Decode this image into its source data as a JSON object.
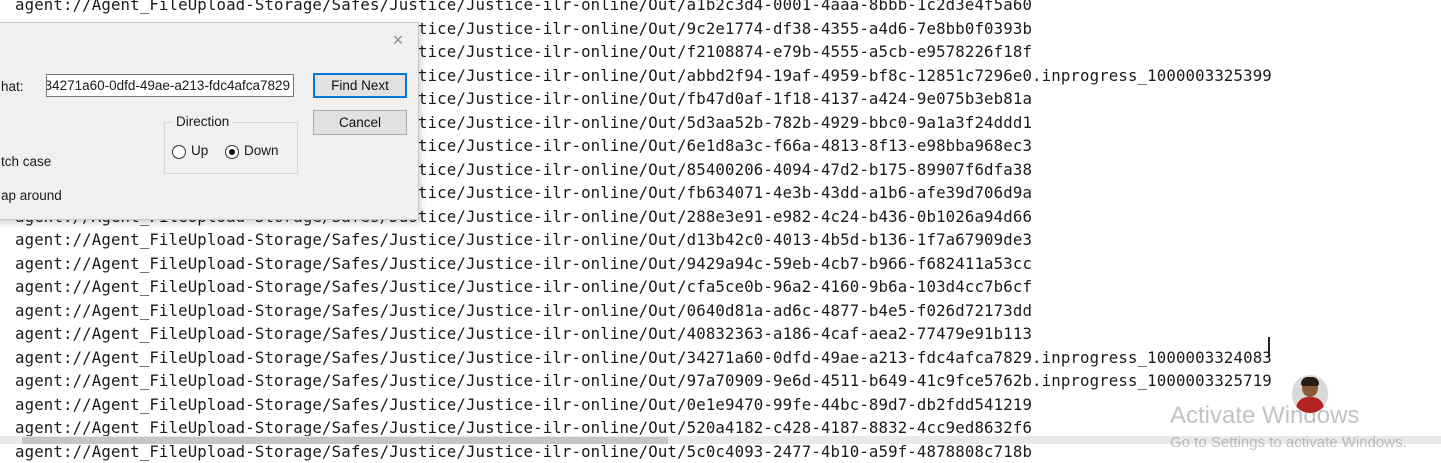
{
  "editor": {
    "lines": [
      "agent://Agent_FileUpload-Storage/Safes/Justice/Justice-ilr-online/Out/a1b2c3d4-0001-4aaa-8bbb-1c2d3e4f5a60",
      "agent://Agent_FileUpload-Storage/Safes/Justice/Justice-ilr-online/Out/9c2e1774-df38-4355-a4d6-7e8bb0f0393b",
      "agent://Agent_FileUpload-Storage/Safes/Justice/Justice-ilr-online/Out/f2108874-e79b-4555-a5cb-e9578226f18f",
      "agent://Agent_FileUpload-Storage/Safes/Justice/Justice-ilr-online/Out/abbd2f94-19af-4959-bf8c-12851c7296e0.inprogress_1000003325399",
      "agent://Agent_FileUpload-Storage/Safes/Justice/Justice-ilr-online/Out/fb47d0af-1f18-4137-a424-9e075b3eb81a",
      "agent://Agent_FileUpload-Storage/Safes/Justice/Justice-ilr-online/Out/5d3aa52b-782b-4929-bbc0-9a1a3f24ddd1",
      "agent://Agent_FileUpload-Storage/Safes/Justice/Justice-ilr-online/Out/6e1d8a3c-f66a-4813-8f13-e98bba968ec3",
      "agent://Agent_FileUpload-Storage/Safes/Justice/Justice-ilr-online/Out/85400206-4094-47d2-b175-89907f6dfa38",
      "agent://Agent_FileUpload-Storage/Safes/Justice/Justice-ilr-online/Out/fb634071-4e3b-43dd-a1b6-afe39d706d9a",
      "agent://Agent_FileUpload-Storage/Safes/Justice/Justice-ilr-online/Out/288e3e91-e982-4c24-b436-0b1026a94d66",
      "agent://Agent_FileUpload-Storage/Safes/Justice/Justice-ilr-online/Out/d13b42c0-4013-4b5d-b136-1f7a67909de3",
      "agent://Agent_FileUpload-Storage/Safes/Justice/Justice-ilr-online/Out/9429a94c-59eb-4cb7-b966-f682411a53cc",
      "agent://Agent_FileUpload-Storage/Safes/Justice/Justice-ilr-online/Out/cfa5ce0b-96a2-4160-9b6a-103d4cc7b6cf",
      "agent://Agent_FileUpload-Storage/Safes/Justice/Justice-ilr-online/Out/0640d81a-ad6c-4877-b4e5-f026d72173dd",
      "agent://Agent_FileUpload-Storage/Safes/Justice/Justice-ilr-online/Out/40832363-a186-4caf-aea2-77479e91b113",
      "agent://Agent_FileUpload-Storage/Safes/Justice/Justice-ilr-online/Out/34271a60-0dfd-49ae-a213-fdc4afca7829.inprogress_1000003324083",
      "agent://Agent_FileUpload-Storage/Safes/Justice/Justice-ilr-online/Out/97a70909-9e6d-4511-b649-41c9fce5762b.inprogress_1000003325719",
      "agent://Agent_FileUpload-Storage/Safes/Justice/Justice-ilr-online/Out/0e1e9470-99fe-44bc-89d7-db2fdd541219",
      "agent://Agent_FileUpload-Storage/Safes/Justice/Justice-ilr-online/Out/520a4182-c428-4187-8832-4cc9ed8632f6",
      "agent://Agent_FileUpload-Storage/Safes/Justice/Justice-ilr-online/Out/5c0c4093-2477-4b10-a59f-4878808c718b"
    ]
  },
  "find_dialog": {
    "close_glyph": "×",
    "find_what_label": "hat:",
    "find_what_value": "34271a60-0dfd-49ae-a213-fdc4afca7829",
    "find_next_label": "Find Next",
    "cancel_label": "Cancel",
    "direction_label": "Direction",
    "direction_up_label": "Up",
    "direction_down_label": "Down",
    "direction_selected": "Down",
    "match_case_label": "tch case",
    "wrap_around_label": "ap around"
  },
  "watermark": {
    "title": "Activate Windows",
    "subtitle": "Go to Settings to activate Windows."
  },
  "colors": {
    "default_button_border": "#0078d7",
    "dialog_background": "#f0f0f0"
  }
}
